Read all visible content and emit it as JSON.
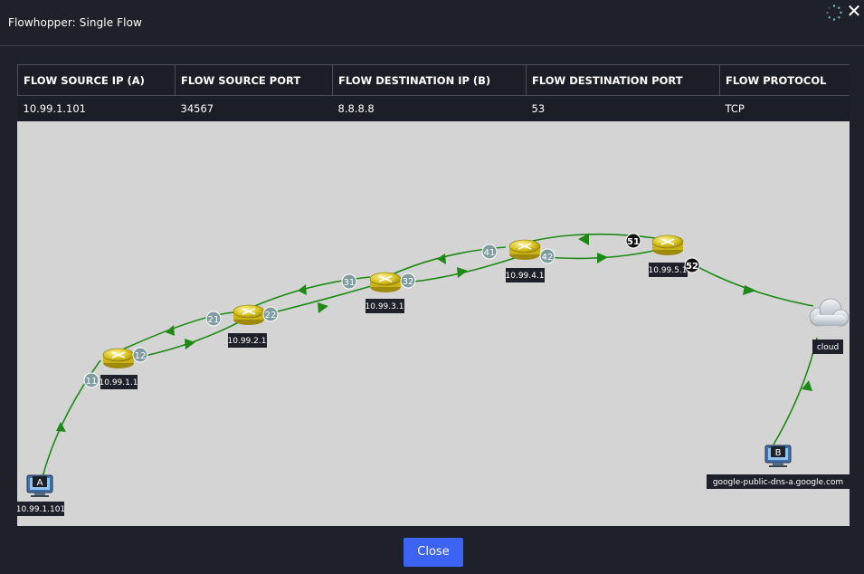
{
  "window": {
    "title": "Flowhopper: Single Flow",
    "icons": [
      "loading-spinner-icon",
      "close-icon"
    ]
  },
  "table": {
    "columns": [
      "FLOW SOURCE IP (A)",
      "FLOW SOURCE PORT",
      "FLOW DESTINATION IP (B)",
      "FLOW DESTINATION PORT",
      "FLOW PROTOCOL"
    ],
    "row": [
      "10.99.1.101",
      "34567",
      "8.8.8.8",
      "53",
      "TCP"
    ]
  },
  "topology": {
    "source": {
      "badge": "A",
      "label": "10.99.1.101",
      "icon": "computer-icon"
    },
    "destination": {
      "badge": "B",
      "label": "google-public-dns-a.google.com",
      "icon": "computer-icon"
    },
    "routers": [
      {
        "label": "10.99.1.1",
        "in_port": "11",
        "out_port": "12",
        "icon": "router-icon"
      },
      {
        "label": "10.99.2.1",
        "in_port": "21",
        "out_port": "22",
        "icon": "router-icon"
      },
      {
        "label": "10.99.3.1",
        "in_port": "31",
        "out_port": "32",
        "icon": "router-icon"
      },
      {
        "label": "10.99.4.1",
        "in_port": "41",
        "out_port": "42",
        "icon": "router-icon"
      },
      {
        "label": "10.99.5.1",
        "in_port": "51",
        "out_port": "52",
        "icon": "router-icon"
      }
    ],
    "cloud": {
      "label": "cloud",
      "icon": "cloud-icon"
    },
    "colors": {
      "link": "#1e8a16",
      "canvas": "#d4d4d4",
      "port": "#7f9da0",
      "active_port": "#111111",
      "label_bg": "#1e2129",
      "router": "#d8c21c"
    }
  },
  "footer": {
    "close_label": "Close"
  }
}
